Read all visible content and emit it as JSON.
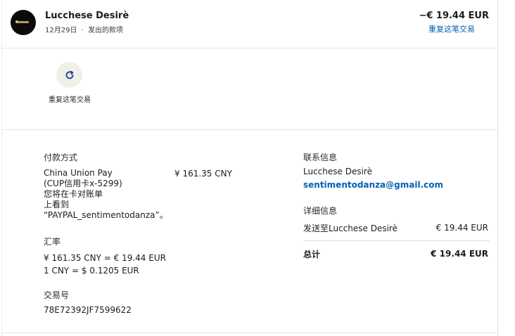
{
  "header": {
    "merchant_name": "Lucchese Desirè",
    "date": "12月29日",
    "separator": "·",
    "type": "发出的款项",
    "amount": "−€ 19.44 EUR",
    "repeat_link": "重复这笔交易"
  },
  "actions": {
    "repeat_label": "重复这笔交易"
  },
  "payment": {
    "heading": "付款方式",
    "method_lines": [
      "China Union Pay",
      "(CUP信用卡x-5299)",
      "您将在卡对账单",
      "上看到",
      "“PAYPAL_sentimentodanza”。"
    ],
    "method_amount": "¥ 161.35 CNY",
    "rate_heading": "汇率",
    "rate_lines": [
      "¥ 161.35 CNY = € 19.44 EUR",
      "1 CNY = $ 0.1205 EUR"
    ],
    "txn_heading": "交易号",
    "txn_id": "78E72392JF7599622"
  },
  "contact": {
    "heading": "联系信息",
    "name": "Lucchese Desirè",
    "email": "sentimentodanza@gmail.com"
  },
  "details": {
    "heading": "详细信息",
    "sent_to_label": "发送至Lucchese Desirè",
    "sent_to_amount": "€ 19.44 EUR",
    "total_label": "总计",
    "total_amount": "€ 19.44 EUR"
  },
  "colors": {
    "link": "#0061b0",
    "avatar_bg": "#0b0b0b",
    "action_circle_bg": "#f1efea"
  }
}
